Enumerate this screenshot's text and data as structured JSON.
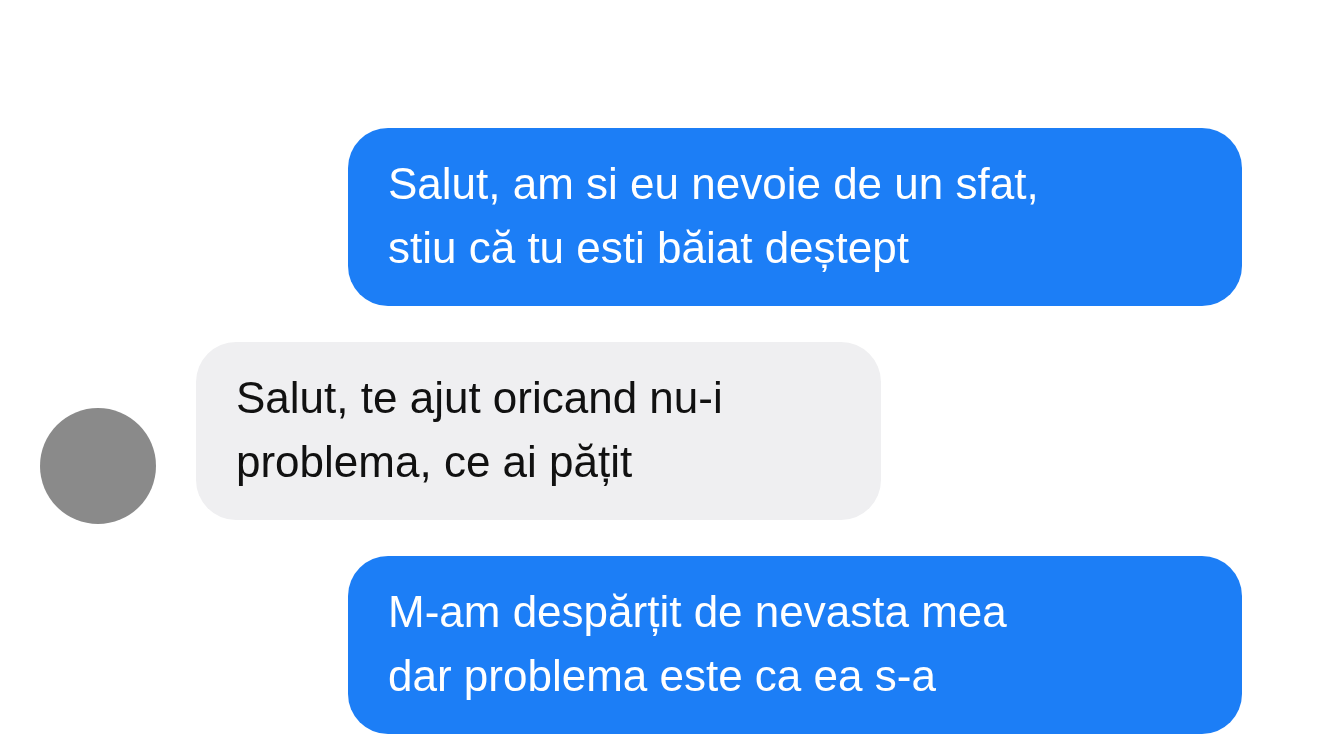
{
  "messages": [
    {
      "kind": "sent",
      "text": "Salut, am si eu nevoie de un sfat,\nstiu că tu esti băiat deștept"
    },
    {
      "kind": "received",
      "text": "Salut, te ajut oricand nu-i\nproblema, ce ai pățit"
    },
    {
      "kind": "sent",
      "text": "M-am despărțit de nevasta mea\ndar problema este ca ea s-a"
    }
  ]
}
